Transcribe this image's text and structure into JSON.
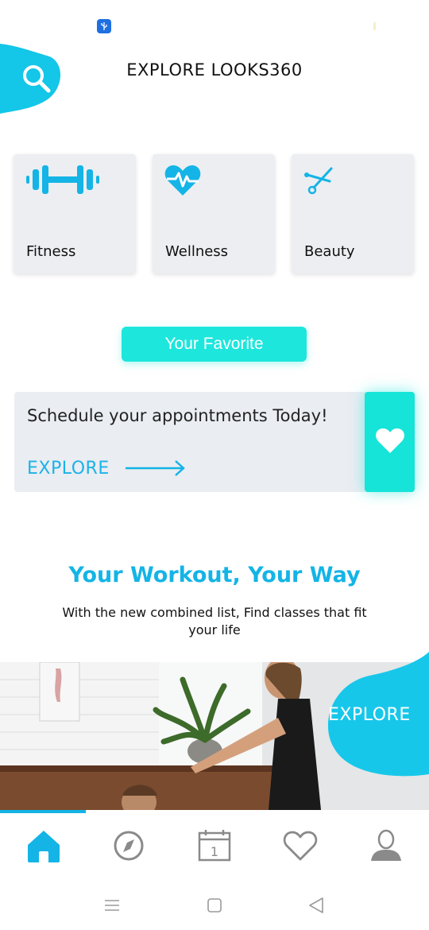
{
  "header": {
    "title": "EXPLORE LOOKS360",
    "search_icon": "search-icon"
  },
  "categories": [
    {
      "label": "Fitness",
      "icon": "dumbbell-icon"
    },
    {
      "label": "Wellness",
      "icon": "heartbeat-icon"
    },
    {
      "label": "Beauty",
      "icon": "scissors-icon"
    }
  ],
  "favorite": {
    "label": "Your Favorite"
  },
  "promo": {
    "text": "Schedule your appointments Today!",
    "explore_label": "EXPLORE",
    "heart_icon": "heart-icon"
  },
  "workout": {
    "title": "Your Workout, Your Way",
    "subtitle": "With the new combined list, Find classes that fit your life",
    "explore_label": "EXPLORE"
  },
  "bottom_nav": {
    "items": [
      {
        "icon": "home-icon",
        "active": true
      },
      {
        "icon": "compass-icon",
        "active": false
      },
      {
        "icon": "calendar-icon",
        "active": false,
        "badge_text": "1"
      },
      {
        "icon": "heart-outline-icon",
        "active": false
      },
      {
        "icon": "profile-icon",
        "active": false
      }
    ]
  },
  "colors": {
    "accent": "#14b4e6",
    "teal": "#1de6dc",
    "card_bg": "#eceef2",
    "nav_inactive": "#8a8a8a"
  }
}
